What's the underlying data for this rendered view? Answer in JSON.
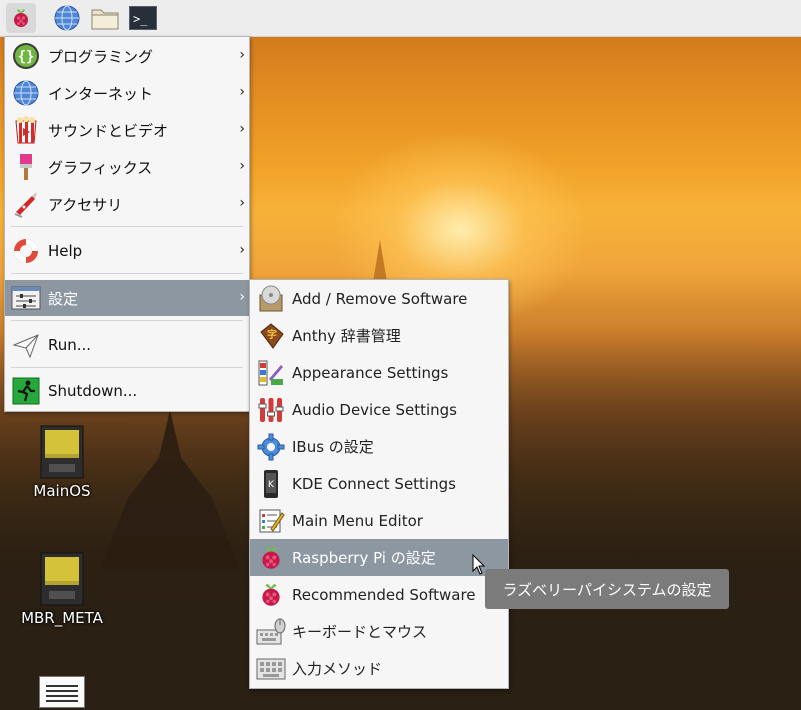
{
  "taskbar": {
    "buttons": [
      {
        "name": "raspberry-menu",
        "icon": "raspberry-icon"
      },
      {
        "name": "web-browser",
        "icon": "globe-icon"
      },
      {
        "name": "file-manager",
        "icon": "folder-icon"
      },
      {
        "name": "terminal",
        "icon": "terminal-icon",
        "glyph": ">_"
      }
    ]
  },
  "main_menu": {
    "items": [
      {
        "label": "プログラミング",
        "icon": "programming-braces-icon",
        "has_submenu": true
      },
      {
        "label": "インターネット",
        "icon": "globe-icon",
        "has_submenu": true
      },
      {
        "label": "サウンドとビデオ",
        "icon": "popcorn-icon",
        "has_submenu": true
      },
      {
        "label": "グラフィックス",
        "icon": "paintbrush-icon",
        "has_submenu": true
      },
      {
        "label": "アクセサリ",
        "icon": "knife-icon",
        "has_submenu": true
      },
      {
        "label": "Help",
        "icon": "lifebuoy-icon",
        "has_submenu": true
      },
      {
        "label": "設定",
        "icon": "settings-sliders-icon",
        "has_submenu": true,
        "selected": true
      },
      {
        "label": "Run...",
        "icon": "paper-plane-icon",
        "has_submenu": false
      },
      {
        "label": "Shutdown...",
        "icon": "exit-running-man-icon",
        "has_submenu": false
      }
    ],
    "arrow": "›"
  },
  "settings_submenu": {
    "items": [
      {
        "label": "Add / Remove Software",
        "icon": "package-disc-icon"
      },
      {
        "label": "Anthy 辞書管理",
        "icon": "dictionary-book-icon"
      },
      {
        "label": "Appearance Settings",
        "icon": "color-swatch-icon"
      },
      {
        "label": "Audio Device Settings",
        "icon": "audio-mixer-icon"
      },
      {
        "label": "IBus の設定",
        "icon": "gear-icon"
      },
      {
        "label": "KDE Connect Settings",
        "icon": "phone-icon"
      },
      {
        "label": "Main Menu Editor",
        "icon": "menu-editor-icon"
      },
      {
        "label": "Raspberry Pi の設定",
        "icon": "raspberry-icon",
        "selected": true
      },
      {
        "label": "Recommended Software",
        "icon": "raspberry-icon"
      },
      {
        "label": "キーボードとマウス",
        "icon": "keyboard-mouse-icon"
      },
      {
        "label": "入力メソッド",
        "icon": "keyboard-icon"
      }
    ]
  },
  "tooltip": {
    "text": "ラズベリーパイシステムの設定"
  },
  "desktop_icons": [
    {
      "label": "MainOS",
      "icon": "sd-card-icon"
    },
    {
      "label": "MBR_META",
      "icon": "sd-card-icon"
    },
    {
      "label": "",
      "icon": "document-icon"
    }
  ],
  "colors": {
    "selection": "#8d97a2",
    "menu_bg": "#f6f6f6",
    "tooltip_bg": "#7b7b7b",
    "raspberry": "#c51a4a",
    "leaf": "#6cc04a"
  }
}
